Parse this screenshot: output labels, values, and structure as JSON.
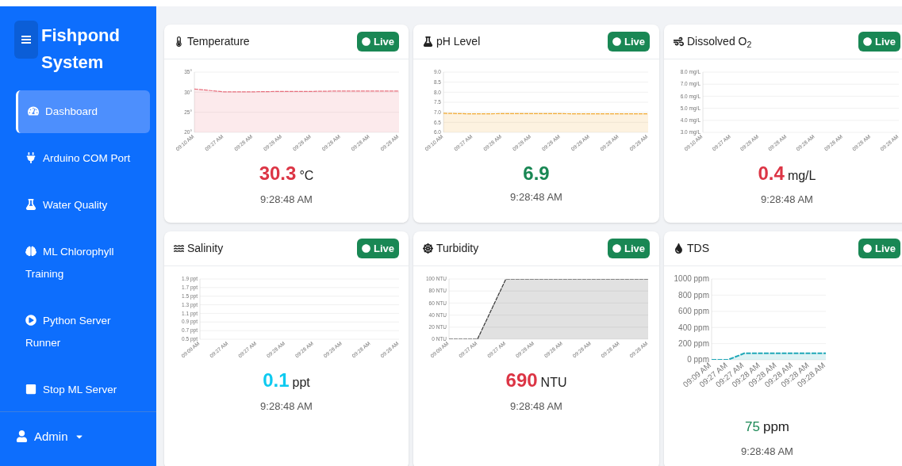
{
  "sidebar": {
    "title": "Fishpond System",
    "items": [
      {
        "label": "Dashboard",
        "selected": true
      },
      {
        "label": "Arduino COM Port",
        "selected": false
      },
      {
        "label": "Water Quality",
        "selected": false
      },
      {
        "label": "ML Chlorophyll Training",
        "selected": false
      },
      {
        "label": "Python Server Runner",
        "selected": false
      },
      {
        "label": "Stop ML Server",
        "selected": false
      }
    ],
    "user": "Admin"
  },
  "cards": [
    {
      "title": "Temperature",
      "status": "Live",
      "value": "30.3",
      "unit": "°C",
      "time": "9:28:48 AM",
      "color": "#dc3545",
      "kind": "wide",
      "chart_data": {
        "type": "area",
        "grid": true,
        "categories": [
          "09:10 AM",
          "09:27 AM",
          "09:28 AM",
          "09:28 AM",
          "09:28 AM",
          "09:28 AM",
          "09:28 AM",
          "09:28 AM"
        ],
        "ylim": [
          20,
          35
        ],
        "yticks": [
          {
            "value": 20,
            "label": "20°"
          },
          {
            "value": 25,
            "label": "25°"
          },
          {
            "value": 30,
            "label": "30°"
          },
          {
            "value": 35,
            "label": "35°"
          }
        ],
        "series": [
          {
            "color": "#e8707e",
            "values": [
              30.8,
              30.1,
              30.1,
              30.2,
              30.2,
              30.3,
              30.3,
              30.3
            ]
          }
        ]
      }
    },
    {
      "title": "pH Level",
      "status": "Live",
      "value": "6.9",
      "time": "9:28:48 AM",
      "color": "#198754",
      "kind": "wide",
      "chart_data": {
        "type": "area",
        "grid": true,
        "categories": [
          "09:10 AM",
          "09:27 AM",
          "09:28 AM",
          "09:28 AM",
          "09:28 AM",
          "09:28 AM",
          "09:28 AM",
          "09:28 AM"
        ],
        "ylim": [
          6,
          9
        ],
        "yticks": [
          {
            "value": 6,
            "label": "6.0"
          },
          {
            "value": 6.5,
            "label": "6.5"
          },
          {
            "value": 7,
            "label": "7.0"
          },
          {
            "value": 7.5,
            "label": "7.5"
          },
          {
            "value": 8,
            "label": "8.0"
          },
          {
            "value": 8.5,
            "label": "8.5"
          },
          {
            "value": 9,
            "label": "9.0"
          }
        ],
        "series": [
          {
            "color": "#f0a830",
            "values": [
              6.95,
              6.92,
              6.93,
              6.93,
              6.93,
              6.92,
              6.92,
              6.92
            ]
          }
        ]
      }
    },
    {
      "title": "Dissolved O$_{2}$",
      "status": "Live",
      "value": "0.4",
      "unit": "mg/L",
      "time": "9:28:48 AM",
      "color": "#dc3545",
      "kind": "wide",
      "chart_data": {
        "type": "area",
        "grid": true,
        "categories": [
          "09:10 AM",
          "09:27 AM",
          "09:28 AM",
          "09:28 AM",
          "09:28 AM",
          "09:28 AM",
          "09:28 AM",
          "09:28 AM"
        ],
        "ylim": [
          3,
          8
        ],
        "yticks": [
          {
            "value": 3,
            "label": "3.0 mg/L"
          },
          {
            "value": 4,
            "label": "4.0 mg/L"
          },
          {
            "value": 5,
            "label": "5.0 mg/L"
          },
          {
            "value": 6,
            "label": "6.0 mg/L"
          },
          {
            "value": 7,
            "label": "7.0 mg/L"
          },
          {
            "value": 8,
            "label": "8.0 mg/L"
          }
        ]
      }
    },
    {
      "title": "Salinity",
      "status": "Live",
      "value": "0.1",
      "unit": "ppt",
      "time": "9:28:48 AM",
      "color": "#0dcaf0",
      "kind": "wide",
      "chart_data": {
        "type": "area",
        "grid": true,
        "categories": [
          "09:09 AM",
          "09:27 AM",
          "09:27 AM",
          "09:28 AM",
          "09:28 AM",
          "09:28 AM",
          "09:28 AM",
          "09:28 AM"
        ],
        "ylim": [
          0.5,
          1.9
        ],
        "yticks": [
          {
            "value": 0.5,
            "label": "0.5 ppt"
          },
          {
            "value": 0.7,
            "label": "0.7 ppt"
          },
          {
            "value": 0.9,
            "label": "0.9 ppt"
          },
          {
            "value": 1.1,
            "label": "1.1 ppt"
          },
          {
            "value": 1.3,
            "label": "1.3 ppt"
          },
          {
            "value": 1.5,
            "label": "1.5 ppt"
          },
          {
            "value": 1.7,
            "label": "1.7 ppt"
          },
          {
            "value": 1.9,
            "label": "1.9 ppt"
          }
        ]
      }
    },
    {
      "title": "Turbidity",
      "status": "Live",
      "value": "690",
      "unit": "NTU",
      "time": "9:28:48 AM",
      "color": "#dc3545",
      "kind": "wide",
      "chart_data": {
        "type": "area",
        "grid": true,
        "categories": [
          "09:09 AM",
          "09:27 AM",
          "09:27 AM",
          "09:28 AM",
          "09:28 AM",
          "09:28 AM",
          "09:28 AM",
          "09:28 AM"
        ],
        "ylim": [
          0,
          100
        ],
        "yticks": [
          {
            "value": 0,
            "label": "0 NTU"
          },
          {
            "value": 20,
            "label": "20 NTU"
          },
          {
            "value": 40,
            "label": "40 NTU"
          },
          {
            "value": 60,
            "label": "60 NTU"
          },
          {
            "value": 80,
            "label": "80 NTU"
          },
          {
            "value": 100,
            "label": "100 NTU"
          }
        ],
        "series": [
          {
            "color": "#333333",
            "values": [
              0,
              0,
              100,
              100,
              100,
              100,
              100,
              100
            ]
          }
        ]
      }
    },
    {
      "title": "TDS",
      "status": "Live",
      "value": "75",
      "unit": "ppm",
      "time": "9:28:48 AM",
      "color": "#198754",
      "kind": "narrow",
      "chart_data": {
        "type": "area",
        "grid": true,
        "categories": [
          "09:09 AM",
          "09:27 AM",
          "09:27 AM",
          "09:28 AM",
          "09:28 AM",
          "09:28 AM",
          "09:28 AM",
          "09:28 AM"
        ],
        "ylim": [
          0,
          1000
        ],
        "yticks": [
          {
            "value": 0,
            "label": "0 ppm"
          },
          {
            "value": 200,
            "label": "200 ppm"
          },
          {
            "value": 400,
            "label": "400 ppm"
          },
          {
            "value": 600,
            "label": "600 ppm"
          },
          {
            "value": 800,
            "label": "800 ppm"
          },
          {
            "value": 1000,
            "label": "1000 ppm"
          }
        ],
        "series": [
          {
            "color": "#20a8b8",
            "values": [
              0,
              0,
              80,
              80,
              80,
              80,
              80,
              80
            ]
          }
        ]
      }
    }
  ]
}
